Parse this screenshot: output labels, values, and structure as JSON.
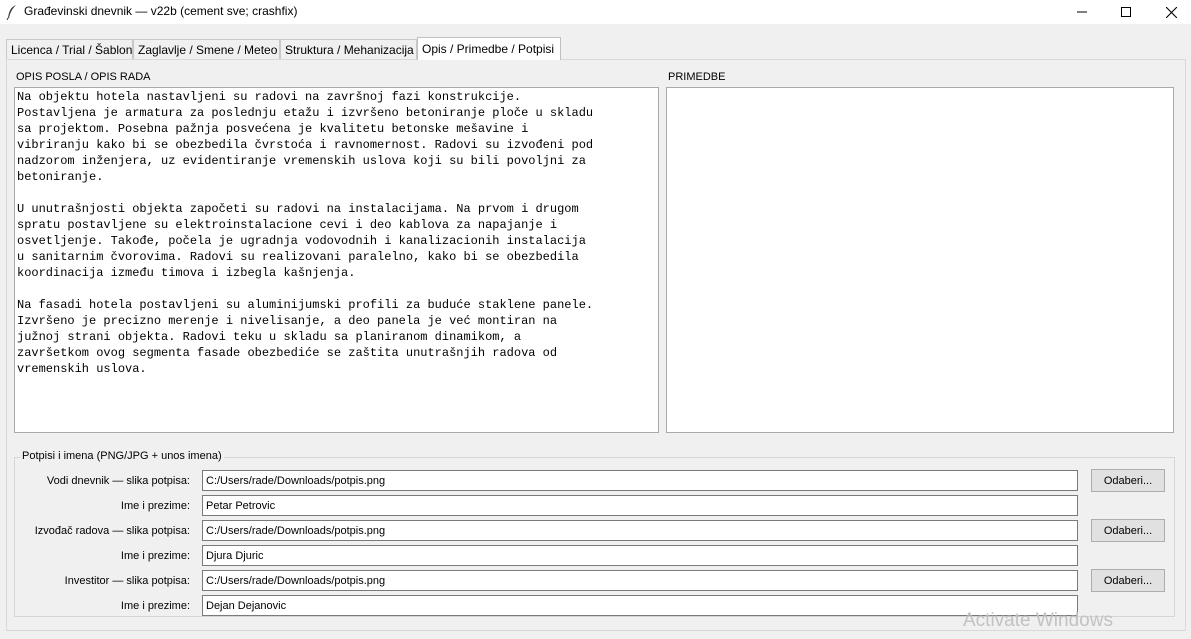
{
  "window": {
    "title": "Građevinski dnevnik — v22b (cement sve; crashfix)"
  },
  "tabs": [
    {
      "label": "Licenca / Trial / Šablon",
      "active": false
    },
    {
      "label": "Zaglavlje / Smene / Meteo",
      "active": false
    },
    {
      "label": "Struktura / Mehanizacija",
      "active": false
    },
    {
      "label": "Opis / Primedbe / Potpisi",
      "active": true
    }
  ],
  "opis": {
    "label": "OPIS POSLA / OPIS RADA",
    "text": "Na objektu hotela nastavljeni su radovi na završnoj fazi konstrukcije.\nPostavljena je armatura za poslednju etažu i izvršeno betoniranje ploče u skladu\nsa projektom. Posebna pažnja posvećena je kvalitetu betonske mešavine i\nvibriranju kako bi se obezbedila čvrstoća i ravnomernost. Radovi su izvođeni pod\nnadzorom inženjera, uz evidentiranje vremenskih uslova koji su bili povoljni za\nbetoniranje.\n\nU unutrašnjosti objekta započeti su radovi na instalacijama. Na prvom i drugom\nspratu postavljene su elektroinstalacione cevi i deo kablova za napajanje i\nosvetljenje. Takođe, počela je ugradnja vodovodnih i kanalizacionih instalacija\nu sanitarnim čvorovima. Radovi su realizovani paralelno, kako bi se obezbedila\nkoordinacija između timova i izbegla kašnjenja.\n\nNa fasadi hotela postavljeni su aluminijumski profili za buduće staklene panele.\nIzvršeno je precizno merenje i nivelisanje, a deo panela je već montiran na\njužnoj strani objekta. Radovi teku u skladu sa planiranom dinamikom, a\nzavršetkom ovog segmenta fasade obezbediće se zaštita unutrašnjih radova od\nvremenskih uslova."
  },
  "primedbe": {
    "label": "PRIMEDBE",
    "text": ""
  },
  "signatures": {
    "legend": "Potpisi i imena (PNG/JPG + unos imena)",
    "browse_label": "Odaberi...",
    "rows": [
      {
        "image_label": "Vodi dnevnik — slika potpisa:",
        "image_path": "C:/Users/rade/Downloads/potpis.png",
        "name_label": "Ime i prezime:",
        "name": "Petar Petrovic"
      },
      {
        "image_label": "Izvođač radova — slika potpisa:",
        "image_path": "C:/Users/rade/Downloads/potpis.png",
        "name_label": "Ime i prezime:",
        "name": "Djura Djuric"
      },
      {
        "image_label": "Investitor — slika potpisa:",
        "image_path": "C:/Users/rade/Downloads/potpis.png",
        "name_label": "Ime i prezime:",
        "name": "Dejan Dejanovic"
      }
    ]
  },
  "os_watermark": {
    "line1": "Activate Windows"
  },
  "icons": {
    "app": "feather-icon",
    "minimize": "minimize-icon",
    "maximize": "maximize-icon",
    "close": "close-icon"
  }
}
